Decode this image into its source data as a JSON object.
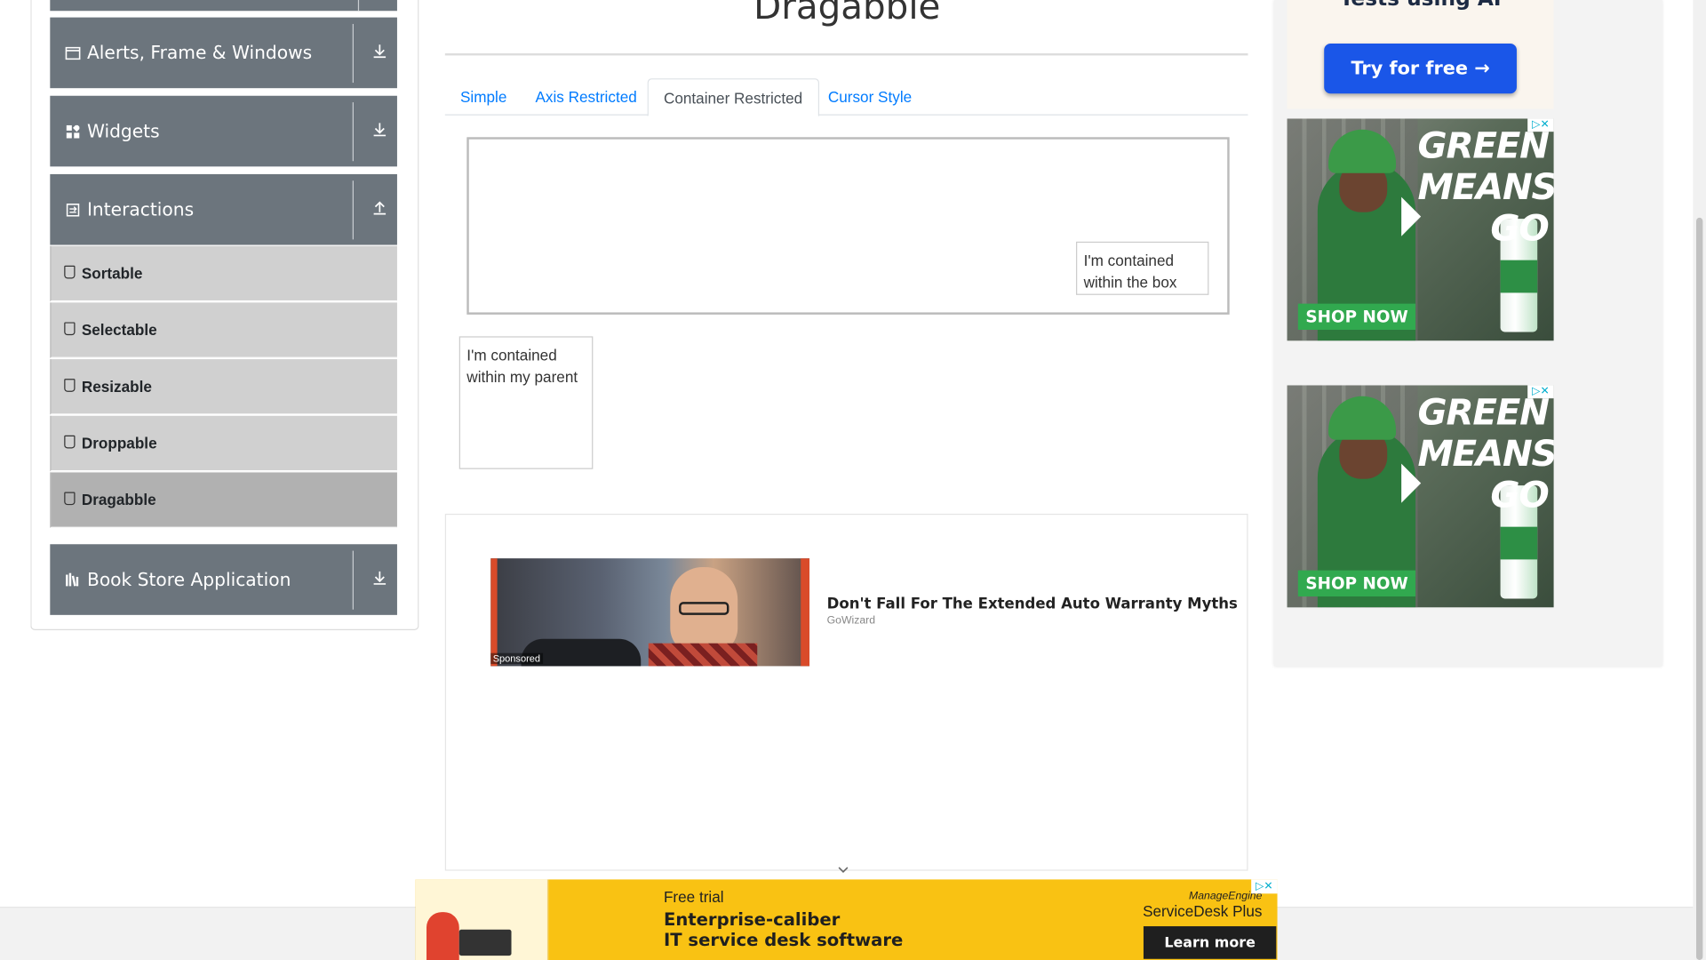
{
  "page": {
    "title": "Dragabble"
  },
  "sidebar": {
    "groups": [
      {
        "label": "Alerts, Frame & Windows",
        "icon": "window-icon",
        "arrow": "download-arrow"
      },
      {
        "label": "Widgets",
        "icon": "widgets-icon",
        "arrow": "download-arrow"
      },
      {
        "label": "Interactions",
        "icon": "interactions-icon",
        "arrow": "upload-arrow"
      },
      {
        "label": "Book Store Application",
        "icon": "bookstore-icon",
        "arrow": "download-arrow"
      }
    ],
    "items": [
      {
        "label": "Sortable"
      },
      {
        "label": "Selectable"
      },
      {
        "label": "Resizable"
      },
      {
        "label": "Droppable"
      },
      {
        "label": "Dragabble",
        "active": true
      }
    ]
  },
  "tabs": [
    {
      "label": "Simple"
    },
    {
      "label": "Axis Restricted"
    },
    {
      "label": "Container Restricted",
      "active": true
    },
    {
      "label": "Cursor Style"
    }
  ],
  "draggables": {
    "box": "I'm contained within the box",
    "parent": "I'm contained within my parent"
  },
  "ad_card": {
    "sponsored": "Sponsored",
    "headline": "Don't Fall For The Extended Auto Warranty Myths",
    "source": "GoWizard"
  },
  "right_ads": {
    "top_text": "Tests using AI",
    "try_button": "Try for free →",
    "green_slogan_lines": [
      "GREEN",
      "MEANS",
      "GO"
    ],
    "shop_now": "SHOP NOW",
    "adchoices": "▷✕"
  },
  "bottom_ad": {
    "free_trial": "Free trial",
    "line1": "Enterprise-caliber",
    "line2": "IT service desk software",
    "brand_top": "ManageEngine",
    "brand": "ServiceDesk Plus",
    "learn_more": "Learn more",
    "adchoices": "▷✕"
  },
  "colors": {
    "sidebar_group": "#6c757d",
    "sidebar_item": "#d0d0d0",
    "sidebar_item_active": "#b1b1b1",
    "link": "#007bff",
    "try_button": "#1a56e8",
    "bottom_ad_bg": "#f9c213"
  }
}
